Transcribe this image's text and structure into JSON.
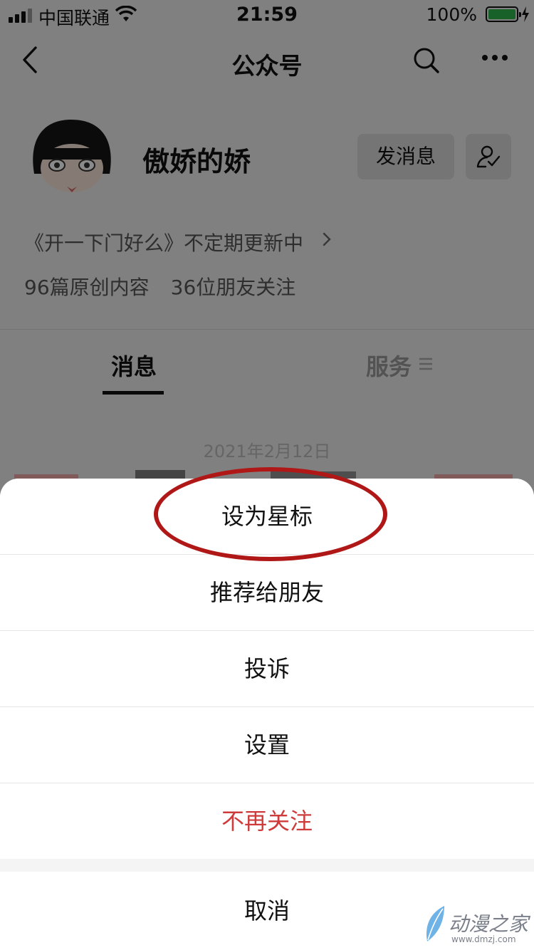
{
  "status_bar": {
    "carrier": "中国联通",
    "time": "21:59",
    "battery_pct": "100%"
  },
  "nav": {
    "title": "公众号"
  },
  "profile": {
    "name": "傲娇的娇",
    "message_button": "发消息",
    "description": "《开一下门好么》不定期更新中",
    "stats_original": "96篇原创内容",
    "stats_friends": "36位朋友关注"
  },
  "tabs": {
    "messages": "消息",
    "services": "服务"
  },
  "feed": {
    "date": "2021年2月12日"
  },
  "action_sheet": {
    "items": [
      {
        "label": "设为星标"
      },
      {
        "label": "推荐给朋友"
      },
      {
        "label": "投诉"
      },
      {
        "label": "设置"
      },
      {
        "label": "不再关注"
      }
    ],
    "cancel": "取消"
  },
  "watermark": {
    "text": "动漫之家",
    "sub": "www.dmzj.com"
  },
  "colors": {
    "danger": "#cf3b3b",
    "highlight": "#b01818",
    "battery": "#2db34a"
  }
}
